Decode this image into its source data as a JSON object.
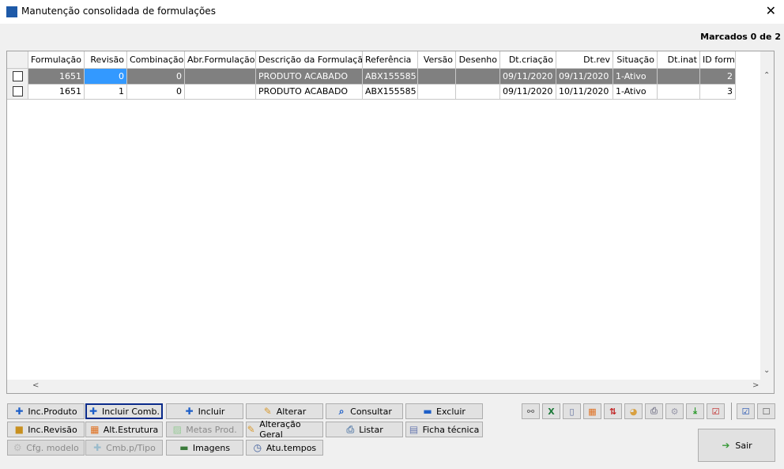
{
  "window": {
    "title": "Manutenção consolidada de formulações",
    "close": "✕"
  },
  "marked": "Marcados 0 de 2",
  "columns": [
    "",
    "Formulação",
    "Revisão",
    "Combinação",
    "Abr.Formulação",
    "Descrição da Formulação",
    "Referência",
    "Versão",
    "Desenho",
    "Dt.criação",
    "Dt.rev",
    "Situação",
    "Dt.inat",
    "ID form"
  ],
  "rows": [
    [
      "",
      "1651",
      "0",
      "0",
      "",
      "PRODUTO ACABADO",
      "ABX155585",
      "",
      "",
      "09/11/2020",
      "09/11/2020",
      "1-Ativo",
      "",
      "2"
    ],
    [
      "",
      "1651",
      "1",
      "0",
      "",
      "PRODUTO ACABADO",
      "ABX155585",
      "",
      "",
      "09/11/2020",
      "10/11/2020",
      "1-Ativo",
      "",
      "3"
    ]
  ],
  "buttons": {
    "inc_produto": "Inc.Produto",
    "incluir_comb": "Incluir Comb.",
    "incluir": "Incluir",
    "alterar": "Alterar",
    "consultar": "Consultar",
    "excluir": "Excluir",
    "inc_revisao": "Inc.Revisão",
    "alt_estrutura": "Alt.Estrutura",
    "metas_prod": "Metas Prod.",
    "alteracao_geral": "Alteração Geral",
    "listar": "Listar",
    "ficha_tecnica": "Ficha técnica",
    "cfg_modelo": "Cfg. modelo",
    "cmb_tipo": "Cmb.p/Tipo",
    "imagens": "Imagens",
    "atu_tempos": "Atu.tempos",
    "sair": "Sair"
  },
  "toolbar_icons": [
    "binoculars-icon",
    "excel-icon",
    "document-icon",
    "grid-edit-icon",
    "sort-icon",
    "palette-icon",
    "print-icon",
    "gear-icon",
    "download-icon",
    "checklist-icon"
  ],
  "colors": {
    "selected_row": "#808080",
    "current_cell": "#3399ff",
    "focus_border": "#0a2a8a"
  }
}
